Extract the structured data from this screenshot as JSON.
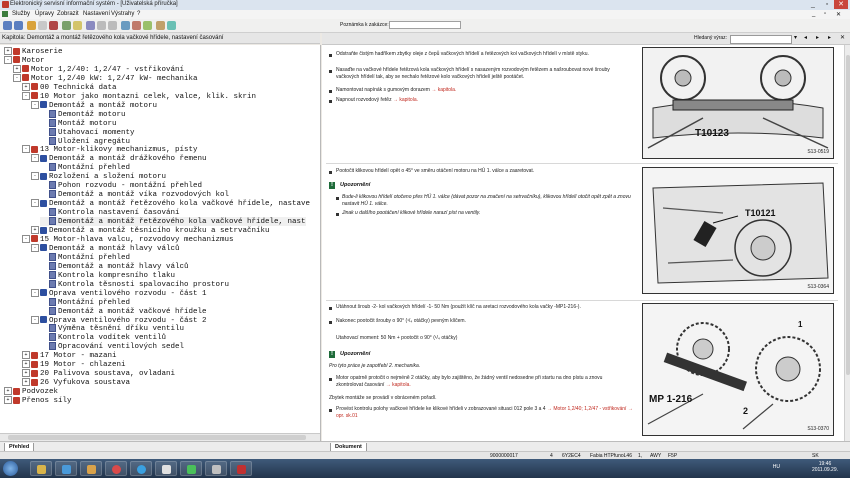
{
  "window": {
    "title": "Elektronický servisní informační systém - [Uživatelská příručka]",
    "minimize": "_",
    "restore": "▫",
    "close": "✕"
  },
  "menu": [
    "Služby",
    "Úpravy",
    "Zobrazit",
    "Nastavení",
    "Výstrahy",
    "?"
  ],
  "toolbar": {
    "note_label": "Poznámka k zakázce:",
    "note_value": ""
  },
  "left_caption": "Kapitola: Demontáž a montáž řetězového kola vačkové hřídele, nastavení časování",
  "search_label": "Hledaný výraz:",
  "search_value": "",
  "tree": [
    {
      "indent": 1,
      "exp": "+",
      "icon": "book",
      "label": "Karoserie"
    },
    {
      "indent": 1,
      "exp": "-",
      "icon": "book",
      "label": "Motor"
    },
    {
      "indent": 2,
      "exp": "+",
      "icon": "book",
      "label": "Motor 1,2/40: 1,2/47 - vstřikování"
    },
    {
      "indent": 2,
      "exp": "-",
      "icon": "book",
      "label": "Motor 1,2/40 kW: 1,2/47 kW- mechanika"
    },
    {
      "indent": 3,
      "exp": "+",
      "icon": "book",
      "label": "00 Technická data"
    },
    {
      "indent": 3,
      "exp": "-",
      "icon": "book",
      "label": "10 Motor jako montazni celek, valce, klik. skrin"
    },
    {
      "indent": 4,
      "exp": "-",
      "icon": "folder",
      "label": "Demontáž a montáž motoru"
    },
    {
      "indent": 5,
      "exp": "",
      "icon": "doc",
      "label": "Demontáž motoru"
    },
    {
      "indent": 5,
      "exp": "",
      "icon": "doc",
      "label": "Montáž motoru"
    },
    {
      "indent": 5,
      "exp": "",
      "icon": "doc",
      "label": "Utahovací momenty"
    },
    {
      "indent": 5,
      "exp": "",
      "icon": "doc",
      "label": "Uložení agregátu"
    },
    {
      "indent": 3,
      "exp": "-",
      "icon": "book",
      "label": "13 Motor-klikovy mechanizmus, písty"
    },
    {
      "indent": 4,
      "exp": "-",
      "icon": "folder",
      "label": "Demontáž a montáž drážkového řemenu"
    },
    {
      "indent": 5,
      "exp": "",
      "icon": "doc",
      "label": "Montážní přehled"
    },
    {
      "indent": 4,
      "exp": "-",
      "icon": "folder",
      "label": "Rozložení a složení motoru"
    },
    {
      "indent": 5,
      "exp": "",
      "icon": "doc",
      "label": "Pohon rozvodu - montážní přehled"
    },
    {
      "indent": 5,
      "exp": "",
      "icon": "doc",
      "label": "Demontáž a montáž víka rozvodových kol"
    },
    {
      "indent": 4,
      "exp": "-",
      "icon": "folder",
      "label": "Demontáž a montáž řetězového kola vačkové hřídele, nastave"
    },
    {
      "indent": 5,
      "exp": "",
      "icon": "doc",
      "label": "Kontrola nastavení časování"
    },
    {
      "indent": 5,
      "exp": "",
      "icon": "doc",
      "label": "Demontáž a montáž řetězového kola vačkové hřídele, nast",
      "selected": true
    },
    {
      "indent": 4,
      "exp": "+",
      "icon": "folder",
      "label": "Demontáž a montáž těsnicího kroužku a setrvačníku"
    },
    {
      "indent": 3,
      "exp": "-",
      "icon": "book",
      "label": "15 Motor-hlava valcu, rozvodovy mechanizmus"
    },
    {
      "indent": 4,
      "exp": "-",
      "icon": "folder",
      "label": "Demontáž a montáž hlavy válců"
    },
    {
      "indent": 5,
      "exp": "",
      "icon": "doc",
      "label": "Montážní přehled"
    },
    {
      "indent": 5,
      "exp": "",
      "icon": "doc",
      "label": "Demontáž a montáž hlavy válců"
    },
    {
      "indent": 5,
      "exp": "",
      "icon": "doc",
      "label": "Kontrola kompresního tlaku"
    },
    {
      "indent": 5,
      "exp": "",
      "icon": "doc",
      "label": "Kontrola těsnosti spalovacího prostoru"
    },
    {
      "indent": 4,
      "exp": "-",
      "icon": "folder",
      "label": "Oprava ventilového rozvodu - část 1"
    },
    {
      "indent": 5,
      "exp": "",
      "icon": "doc",
      "label": "Montážní přehled"
    },
    {
      "indent": 5,
      "exp": "",
      "icon": "doc",
      "label": "Demontáž a montáž vačkové hřídele"
    },
    {
      "indent": 4,
      "exp": "-",
      "icon": "folder",
      "label": "Oprava ventilového rozvodu - část 2"
    },
    {
      "indent": 5,
      "exp": "",
      "icon": "doc",
      "label": "Výměna těsnění dříku ventilu"
    },
    {
      "indent": 5,
      "exp": "",
      "icon": "doc",
      "label": "Kontrola vodítek ventilů"
    },
    {
      "indent": 5,
      "exp": "",
      "icon": "doc",
      "label": "Opracování ventilových sedel"
    },
    {
      "indent": 3,
      "exp": "+",
      "icon": "book",
      "label": "17 Motor - mazani"
    },
    {
      "indent": 3,
      "exp": "+",
      "icon": "book",
      "label": "19 Motor - chlazeni"
    },
    {
      "indent": 3,
      "exp": "+",
      "icon": "book",
      "label": "20 Palivova soustava, ovladani"
    },
    {
      "indent": 3,
      "exp": "+",
      "icon": "book",
      "label": "26 Vyfukova soustava"
    },
    {
      "indent": 1,
      "exp": "+",
      "icon": "book",
      "label": "Podvozek"
    },
    {
      "indent": 1,
      "exp": "+",
      "icon": "book",
      "label": "Přenos síly"
    }
  ],
  "doc": {
    "p1": "Odstraňte čistým hadříkem zbytky oleje z čepů vačkových hřídelí a řetězových kol vačkových hřídelí v místě styku.",
    "p2": "Nasaďte na vačkové hřídele řetězová kola vačkových hřídelí s nasazeným rozvodovým řetězem a našroubovat nové šrouby vačkových hřídelí tak, aby se nechalo řetězové kolo vačkových hřídelí ještě pootáčet.",
    "p3a": "Namontovat napínák s gumovým dorazem",
    "p3link": "→ kapitola.",
    "p4a": "Napnout rozvodový řetěz",
    "p4link": "→ kapitola.",
    "p5": "Pootočit klikovou hřídelí opět o 45° ve směru otáčení motoru na HÚ 1. válce a zaaretovat.",
    "note1_head": "Upozornění",
    "note1_a": "Bude-li klikovou hřídelí otočeno přes HÚ 1. válce (dávat pozor na značení na setrvačníku), klikovou hřídelí otočit opět zpět a znovu nastavit HÚ 1. válce.",
    "note1_b": "Jinak u dalšího pootáčení klikové hřídele narazí píst na ventily.",
    "p6": "Utáhnout šroub -2- kol vačkových hřídelí -1- 50 Nm (použít klíč na aretaci rozvodového kola vačky -MP1-216-).",
    "p7": "Nakonec pootočit šrouby o 90° (¹/₄ otáčky) pevným klíčem.",
    "p8": "Utahovací moment: 50 Nm + pootočit o 90° (¹/₄ otáčky)",
    "note2_head": "Upozornění",
    "p9": "Pro tyto práce je zapotřebí 2. mechanika.",
    "p10a": "Motor opatrně protočit o nejméně 2 otáčky, aby bylo zajištěno, že žádný ventil nedosedne při startu na dno pístu a znovu zkontrolovat časování",
    "p10link": "→ kapitola.",
    "p11": "Zbytek montáže se provádí v obráceném pořadí.",
    "p12a": "Provést kontrolu polohy vačkové hřídele ke klikové hřídeli v zobrazované situaci 012 pole 3 a 4",
    "p12link": "→ Motor 1,2/40; 1,2/47 - vstřikování → opr. sk.01"
  },
  "figures": [
    {
      "label": "T10123",
      "code": "S13-0519"
    },
    {
      "label": "T10121",
      "code": "S13-0364"
    },
    {
      "label": "MP 1-216",
      "label2": "2",
      "label1": "1",
      "code": "S13-0370"
    }
  ],
  "tabs": {
    "left": "Přehled",
    "right": "Dokument"
  },
  "status": {
    "s1": "9000000017",
    "s2": "4",
    "s3": "6Y2EC4",
    "s4": "Fabia HTPfunoL46",
    "s5": "1,",
    "s6": "AWY",
    "s7": "F5P",
    "s8": "SK"
  },
  "taskbar": {
    "lang": "HU",
    "time": "19:46",
    "date": "2011.09.29."
  },
  "colors": {
    "link": "#c0281e",
    "accent": "#2d4fa0",
    "note": "#1e6b3a"
  }
}
